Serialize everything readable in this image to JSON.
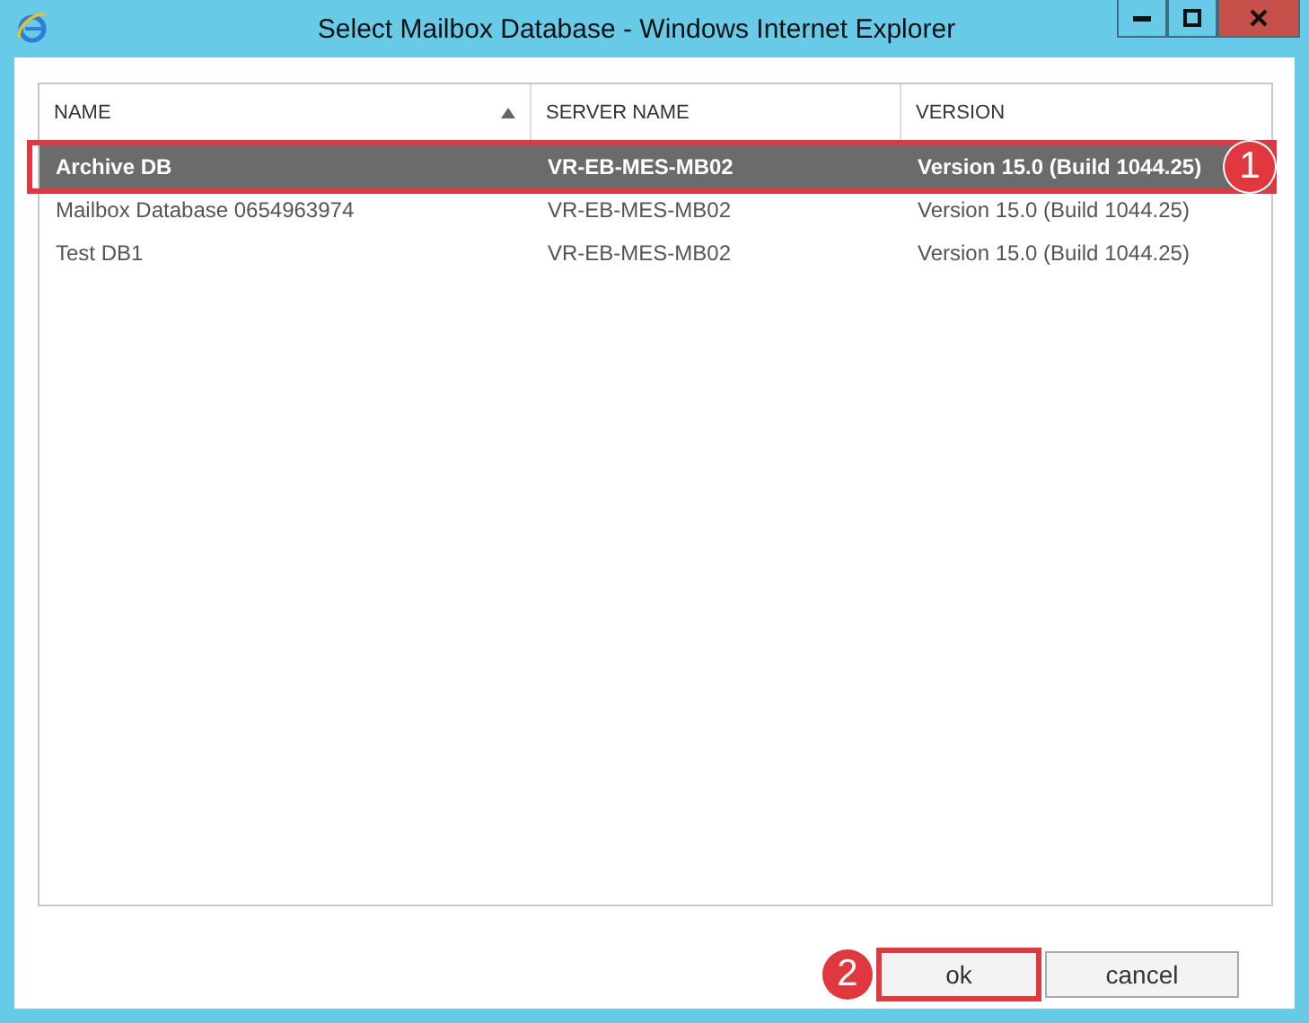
{
  "window": {
    "title": "Select Mailbox Database - Windows Internet Explorer"
  },
  "table": {
    "columns": [
      {
        "label": "NAME",
        "sorted": true
      },
      {
        "label": "SERVER NAME",
        "sorted": false
      },
      {
        "label": "VERSION",
        "sorted": false
      }
    ],
    "rows": [
      {
        "cells": [
          "Archive DB",
          "VR-EB-MES-MB02",
          "Version 15.0 (Build 1044.25)"
        ],
        "selected": true,
        "callout": "1"
      },
      {
        "cells": [
          "Mailbox Database 0654963974",
          "VR-EB-MES-MB02",
          "Version 15.0 (Build 1044.25)"
        ],
        "selected": false
      },
      {
        "cells": [
          "Test DB1",
          "VR-EB-MES-MB02",
          "Version 15.0 (Build 1044.25)"
        ],
        "selected": false
      }
    ]
  },
  "buttons": [
    {
      "label": "ok",
      "callout": "2"
    },
    {
      "label": "cancel"
    }
  ]
}
